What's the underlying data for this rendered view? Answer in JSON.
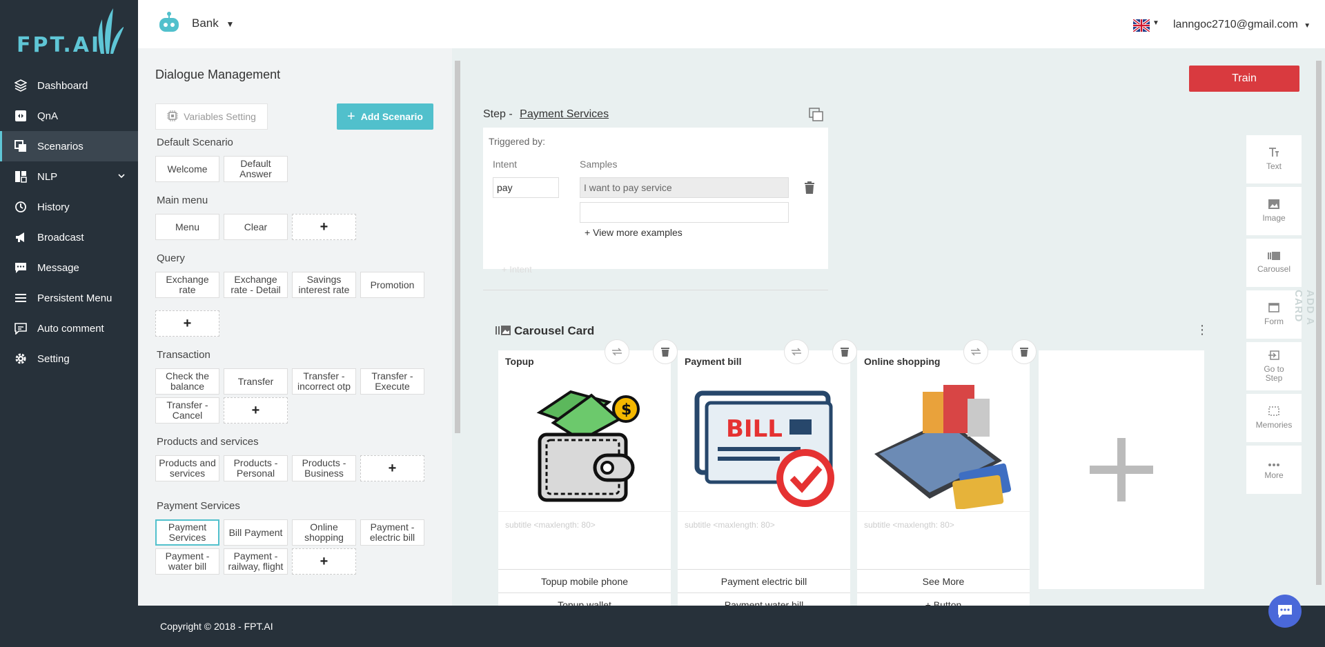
{
  "brand": {
    "logo_text": "FPT.AI"
  },
  "sidebar": {
    "items": [
      {
        "label": "Dashboard",
        "icon": "layers-icon"
      },
      {
        "label": "QnA",
        "icon": "qna-icon"
      },
      {
        "label": "Scenarios",
        "icon": "scenarios-icon"
      },
      {
        "label": "NLP",
        "icon": "nlp-icon"
      },
      {
        "label": "History",
        "icon": "history-icon"
      },
      {
        "label": "Broadcast",
        "icon": "megaphone-icon"
      },
      {
        "label": "Message",
        "icon": "message-icon"
      },
      {
        "label": "Persistent Menu",
        "icon": "menu-icon"
      },
      {
        "label": "Auto comment",
        "icon": "comment-icon"
      },
      {
        "label": "Setting",
        "icon": "gear-icon"
      }
    ],
    "active": "Scenarios"
  },
  "topbar": {
    "bot_name": "Bank",
    "email": "lanngoc2710@gmail.com",
    "language": "English"
  },
  "dialogue": {
    "title": "Dialogue Management",
    "variables_setting": "Variables Setting",
    "add_scenario": "Add Scenario",
    "sections": {
      "default": {
        "title": "Default Scenario",
        "items": [
          "Welcome",
          "Default Answer"
        ]
      },
      "main_menu": {
        "title": "Main menu",
        "items": [
          "Menu",
          "Clear"
        ]
      },
      "query": {
        "title": "Query",
        "items": [
          "Exchange rate",
          "Exchange rate - Detail",
          "Savings interest rate",
          "Promotion"
        ]
      },
      "transaction": {
        "title": "Transaction",
        "items": [
          "Check the balance",
          "Transfer",
          "Transfer - incorrect otp",
          "Transfer - Execute",
          "Transfer - Cancel"
        ]
      },
      "products": {
        "title": "Products and services",
        "items": [
          "Products and services",
          "Products - Personal",
          "Products - Business"
        ]
      },
      "payment": {
        "title": "Payment Services",
        "items": [
          "Payment Services",
          "Bill Payment",
          "Online shopping",
          "Payment - electric bill",
          "Payment - water bill",
          "Payment - railway, flight"
        ]
      }
    },
    "plus": "+"
  },
  "step": {
    "prefix": "Step -",
    "name": "Payment Services",
    "triggered_by": "Triggered by:",
    "intent_label": "Intent",
    "samples_label": "Samples",
    "intent_value": "pay",
    "sample_1": "I want to pay service",
    "view_more": "+ View more examples",
    "add_intent": "+ Intent"
  },
  "train_button": "Train",
  "carousel": {
    "title": "Carousel Card",
    "cards": [
      {
        "title": "Topup",
        "subtitle_placeholder": "subtitle <maxlength: 80>",
        "buttons": [
          "Topup mobile phone",
          "Topup wallet"
        ]
      },
      {
        "title": "Payment bill",
        "subtitle_placeholder": "subtitle <maxlength: 80>",
        "buttons": [
          "Payment electric bill",
          "Payment water bill"
        ]
      },
      {
        "title": "Online shopping",
        "subtitle_placeholder": "subtitle <maxlength: 80>",
        "buttons": [
          "See More",
          "+ Button"
        ]
      }
    ],
    "bill_text": "BILL"
  },
  "tools": {
    "items": [
      "Text",
      "Image",
      "Carousel",
      "Form",
      "Go to Step",
      "Memories",
      "More"
    ],
    "add_a_card": "ADD A CARD"
  },
  "footer": {
    "copyright": "Copyright © 2018 - FPT.AI"
  },
  "colors": {
    "sidebar": "#27313a",
    "accent": "#51c0cc",
    "train": "#d93a3f",
    "chat": "#4a68d9"
  }
}
